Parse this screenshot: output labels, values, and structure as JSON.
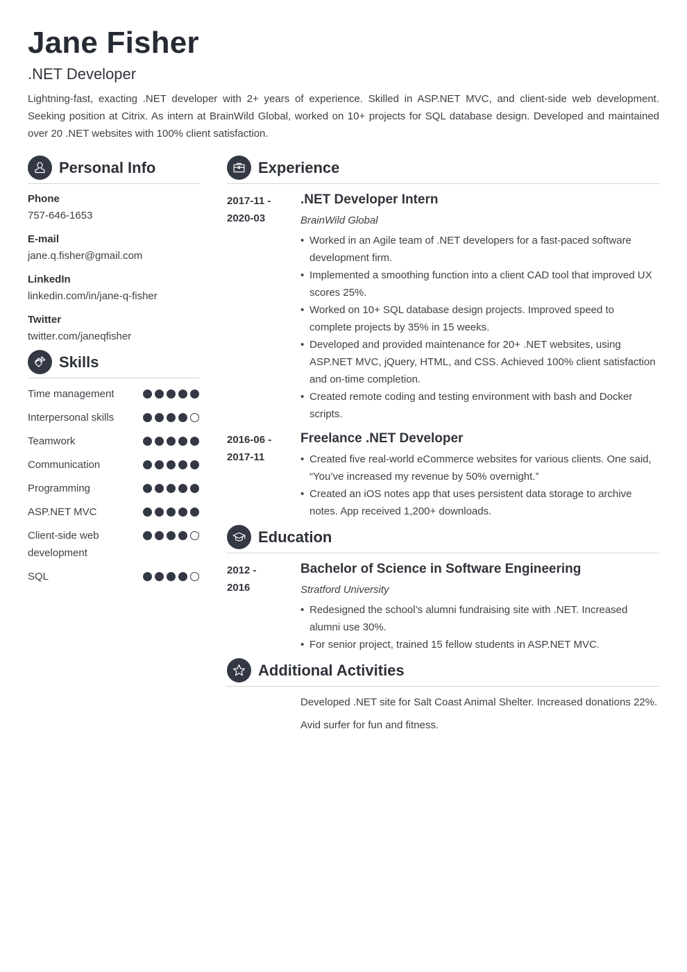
{
  "header": {
    "name": "Jane Fisher",
    "title": ".NET Developer",
    "summary": "Lightning-fast, exacting .NET developer with 2+ years of experience. Skilled in ASP.NET MVC, and client-side web development. Seeking position at Citrix. As intern at BrainWild Global, worked on 10+ projects for SQL database design. Developed and maintained over 20 .NET websites with 100% client satisfaction."
  },
  "theme": {
    "accent": "#333844",
    "text": "#3c3f45",
    "divider": "#d3d3d3"
  },
  "personal_info": {
    "heading": "Personal Info",
    "icon": "user-icon",
    "fields": [
      {
        "label": "Phone",
        "value": "757-646-1653"
      },
      {
        "label": "E-mail",
        "value": "jane.q.fisher@gmail.com"
      },
      {
        "label": "LinkedIn",
        "value": "linkedin.com/in/jane-q-fisher"
      },
      {
        "label": "Twitter",
        "value": "twitter.com/janeqfisher"
      }
    ]
  },
  "skills": {
    "heading": "Skills",
    "icon": "puzzle-icon",
    "max_level": 5,
    "items": [
      {
        "name": "Time management",
        "level": 5
      },
      {
        "name": "Interpersonal skills",
        "level": 4
      },
      {
        "name": "Teamwork",
        "level": 5
      },
      {
        "name": "Communication",
        "level": 5
      },
      {
        "name": "Programming",
        "level": 5
      },
      {
        "name": "ASP.NET MVC",
        "level": 5
      },
      {
        "name": "Client-side web development",
        "level": 4
      },
      {
        "name": "SQL",
        "level": 4
      }
    ]
  },
  "experience": {
    "heading": "Experience",
    "icon": "briefcase-icon",
    "entries": [
      {
        "date_start": "2017-11 -",
        "date_end": "2020-03",
        "role": ".NET Developer Intern",
        "org": "BrainWild Global",
        "bullets": [
          "Worked in an Agile team of .NET developers for a fast-paced software development firm.",
          "Implemented a smoothing function into a client CAD tool that improved UX scores 25%.",
          "Worked on 10+ SQL database design projects. Improved speed to complete projects by 35% in 15 weeks.",
          "Developed and provided maintenance for 20+ .NET websites, using ASP.NET MVC, jQuery, HTML, and CSS. Achieved 100% client satisfaction and on-time completion.",
          "Created remote coding and testing environment with bash and Docker scripts."
        ]
      },
      {
        "date_start": "2016-06 -",
        "date_end": "2017-11",
        "role": "Freelance .NET Developer",
        "org": "",
        "bullets": [
          "Created five real-world eCommerce websites for various clients. One said, “You’ve increased my revenue by 50% overnight.”",
          "Created an iOS notes app that uses persistent data storage to archive notes. App received 1,200+ downloads."
        ]
      }
    ]
  },
  "education": {
    "heading": "Education",
    "icon": "graduation-cap-icon",
    "entries": [
      {
        "date_start": "2012 -",
        "date_end": "2016",
        "role": "Bachelor of Science in Software Engineering",
        "org": "Stratford University",
        "bullets": [
          "Redesigned the school’s alumni fundraising site with .NET. Increased alumni use 30%.",
          "For senior project, trained 15 fellow students in ASP.NET MVC."
        ]
      }
    ]
  },
  "activities": {
    "heading": "Additional Activities",
    "icon": "star-icon",
    "items": [
      "Developed .NET site for Salt Coast Animal Shelter. Increased donations 22%.",
      "Avid surfer for fun and fitness."
    ]
  }
}
